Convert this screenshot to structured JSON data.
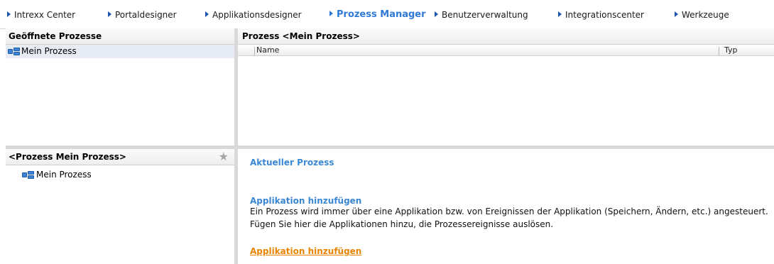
{
  "nav": {
    "items": [
      {
        "label": "Intrexx Center"
      },
      {
        "label": "Portaldesigner"
      },
      {
        "label": "Applikationsdesigner"
      },
      {
        "label": "Prozess Manager"
      },
      {
        "label": "Benutzerverwaltung"
      },
      {
        "label": "Integrationscenter"
      },
      {
        "label": "Werkzeuge"
      }
    ],
    "active_index": 3,
    "colors": {
      "normal": "#1a1a1a",
      "active": "#2e7ad6"
    }
  },
  "open_processes": {
    "title": "Geöffnete Prozesse",
    "items": [
      {
        "label": "Mein Prozess",
        "icon": "process-icon"
      }
    ]
  },
  "process_pane": {
    "title": "Prozess <Mein Prozess>",
    "columns": [
      {
        "label": "Name"
      },
      {
        "label": "Typ"
      }
    ]
  },
  "tree_pane": {
    "title": "<Prozess Mein Prozess>",
    "star_icon": "star-icon",
    "items": [
      {
        "label": "Mein Prozess",
        "icon": "process-icon"
      }
    ]
  },
  "info_pane": {
    "heading": "Aktueller Prozess",
    "section_title": "Applikation hinzufügen",
    "text_line1": "Ein Prozess wird immer über eine Applikation bzw. von Ereignissen der Applikation (Speichern, Ändern, etc.) angesteuert.",
    "text_line2": "Fügen Sie hier die Applikationen hinzu, die Prozessereignisse auslösen.",
    "link": "Applikation hinzufügen",
    "colors": {
      "heading": "#3a87d4",
      "link": "#e88400"
    }
  }
}
